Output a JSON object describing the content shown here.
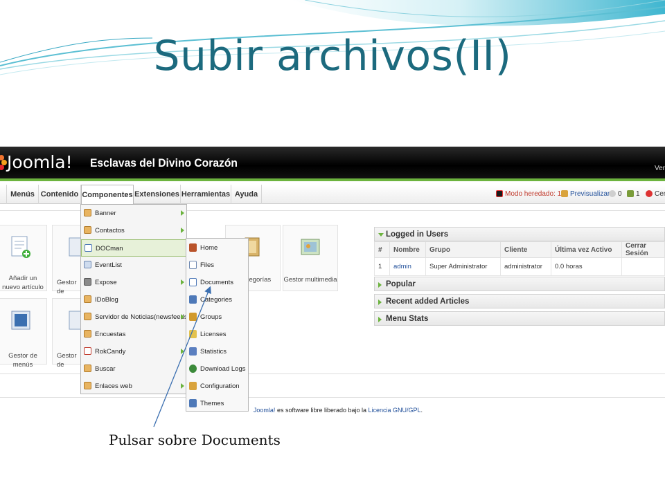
{
  "slide": {
    "title": "Subir archivos(II)",
    "annotation": "Pulsar sobre Documents"
  },
  "header": {
    "logo_text": "Joomla!",
    "site_name": "Esclavas del Divino Corazón",
    "version_text": "Ver"
  },
  "menu": {
    "items": [
      "Menús",
      "Contenido",
      "Componentes",
      "Extensiones",
      "Herramientas",
      "Ayuda"
    ]
  },
  "status": {
    "legacy_mode": "Modo heredado: 1.0",
    "preview": "Previsualizar",
    "messages_count": "0",
    "users_count": "1",
    "logout": "Cer"
  },
  "cpanel": {
    "items": [
      "Añadir un nuevo artículo",
      "Gestor de",
      "e categorías",
      "Gestor multimedia",
      "Gestor de menús",
      "Gestor de"
    ]
  },
  "components_menu": {
    "items": [
      "Banner",
      "Contactos",
      "DOCman",
      "EventList",
      "Expose",
      "IDoBlog",
      "Servidor de Noticias(newsfeeds)",
      "Encuestas",
      "RokCandy",
      "Buscar",
      "Enlaces web"
    ]
  },
  "docman_menu": {
    "items": [
      "Home",
      "Files",
      "Documents",
      "Categories",
      "Groups",
      "Licenses",
      "Statistics",
      "Download Logs",
      "Configuration",
      "Themes"
    ]
  },
  "modules": {
    "logged_in": {
      "title": "Logged in Users",
      "columns": [
        "#",
        "Nombre",
        "Grupo",
        "Cliente",
        "Última vez Activo",
        "Cerrar Sesión"
      ],
      "rows": [
        [
          "1",
          "admin",
          "Super Administrator",
          "administrator",
          "0.0 horas",
          ""
        ]
      ]
    },
    "popular": "Popular",
    "recent": "Recent added Articles",
    "menu_stats": "Menu Stats"
  },
  "footer": {
    "prefix": "Joomla!",
    "middle": " es software libre liberado bajo la ",
    "license": "Licencia GNU/GPL",
    "suffix": "."
  }
}
